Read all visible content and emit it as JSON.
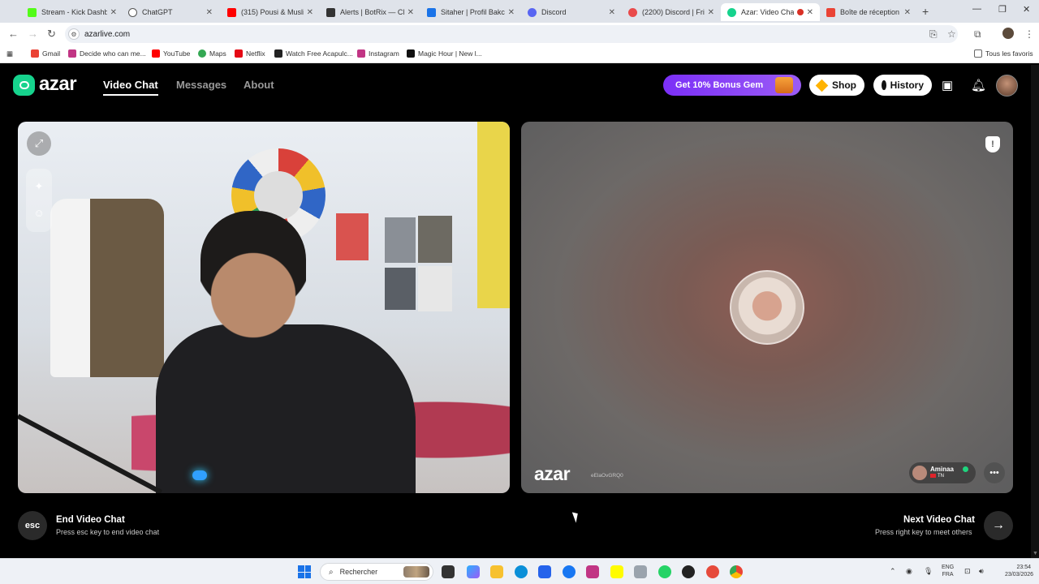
{
  "browser": {
    "tabs": [
      {
        "title": "Stream - Kick Dashbo",
        "color": "#53fc18"
      },
      {
        "title": "ChatGPT",
        "color": "#555555"
      },
      {
        "title": "(315) Pousi & Muslim",
        "color": "#ff0000"
      },
      {
        "title": "Alerts | BotRix — Clo",
        "color": "#333333"
      },
      {
        "title": "Sitaher | Profil Bakch",
        "color": "#1a73e8"
      },
      {
        "title": "Discord",
        "color": "#5865f2"
      },
      {
        "title": "(2200) Discord | Frien",
        "color": "#5865f2"
      },
      {
        "title": "Azar: Video Chat",
        "color": "#16d38d"
      },
      {
        "title": "Boîte de réception (2",
        "color": "#ea4335"
      }
    ],
    "url": "azarlive.com",
    "bookmarks": [
      {
        "label": "Gmail",
        "color": "#ea4335"
      },
      {
        "label": "Decide who can me...",
        "color": "#c13584"
      },
      {
        "label": "YouTube",
        "color": "#ff0000"
      },
      {
        "label": "Maps",
        "color": "#34a853"
      },
      {
        "label": "Netflix",
        "color": "#e50914"
      },
      {
        "label": "Watch Free Acapulc...",
        "color": "#222222"
      },
      {
        "label": "Instagram",
        "color": "#c13584"
      },
      {
        "label": "Magic Hour | New l...",
        "color": "#111111"
      }
    ],
    "all_bookmarks": "Tous les favoris"
  },
  "azar": {
    "logo": "azar",
    "nav": {
      "video_chat": "Video Chat",
      "messages": "Messages",
      "about": "About"
    },
    "bonus_banner": "Get 10% Bonus Gem",
    "shop": "Shop",
    "history": "History",
    "partner": {
      "name": "Aminaa",
      "country": "TN",
      "session_id": "eElaOvGRQ0"
    },
    "end_chat": {
      "key": "esc",
      "title": "End Video Chat",
      "subtitle": "Press esc key to end video chat"
    },
    "next_chat": {
      "title": "Next Video Chat",
      "subtitle": "Press right key to meet others"
    }
  },
  "taskbar": {
    "search_placeholder": "Rechercher",
    "lang_top": "ENG",
    "lang_bottom": "FRA",
    "time": "23:54",
    "date": "23/03/2026"
  }
}
